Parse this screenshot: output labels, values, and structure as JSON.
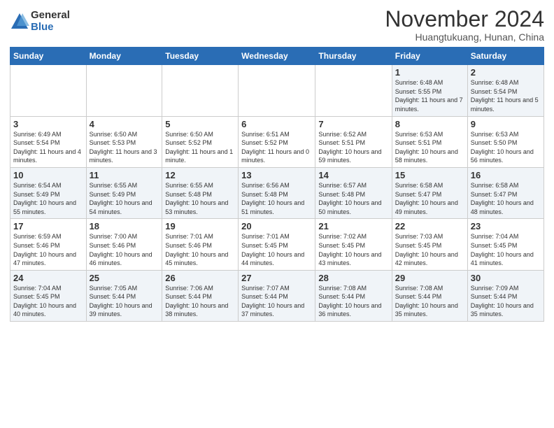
{
  "logo": {
    "general": "General",
    "blue": "Blue"
  },
  "header": {
    "title": "November 2024",
    "subtitle": "Huangtukuang, Hunan, China"
  },
  "days_of_week": [
    "Sunday",
    "Monday",
    "Tuesday",
    "Wednesday",
    "Thursday",
    "Friday",
    "Saturday"
  ],
  "weeks": [
    [
      {
        "day": "",
        "info": ""
      },
      {
        "day": "",
        "info": ""
      },
      {
        "day": "",
        "info": ""
      },
      {
        "day": "",
        "info": ""
      },
      {
        "day": "",
        "info": ""
      },
      {
        "day": "1",
        "info": "Sunrise: 6:48 AM\nSunset: 5:55 PM\nDaylight: 11 hours and 7 minutes."
      },
      {
        "day": "2",
        "info": "Sunrise: 6:48 AM\nSunset: 5:54 PM\nDaylight: 11 hours and 5 minutes."
      }
    ],
    [
      {
        "day": "3",
        "info": "Sunrise: 6:49 AM\nSunset: 5:54 PM\nDaylight: 11 hours and 4 minutes."
      },
      {
        "day": "4",
        "info": "Sunrise: 6:50 AM\nSunset: 5:53 PM\nDaylight: 11 hours and 3 minutes."
      },
      {
        "day": "5",
        "info": "Sunrise: 6:50 AM\nSunset: 5:52 PM\nDaylight: 11 hours and 1 minute."
      },
      {
        "day": "6",
        "info": "Sunrise: 6:51 AM\nSunset: 5:52 PM\nDaylight: 11 hours and 0 minutes."
      },
      {
        "day": "7",
        "info": "Sunrise: 6:52 AM\nSunset: 5:51 PM\nDaylight: 10 hours and 59 minutes."
      },
      {
        "day": "8",
        "info": "Sunrise: 6:53 AM\nSunset: 5:51 PM\nDaylight: 10 hours and 58 minutes."
      },
      {
        "day": "9",
        "info": "Sunrise: 6:53 AM\nSunset: 5:50 PM\nDaylight: 10 hours and 56 minutes."
      }
    ],
    [
      {
        "day": "10",
        "info": "Sunrise: 6:54 AM\nSunset: 5:49 PM\nDaylight: 10 hours and 55 minutes."
      },
      {
        "day": "11",
        "info": "Sunrise: 6:55 AM\nSunset: 5:49 PM\nDaylight: 10 hours and 54 minutes."
      },
      {
        "day": "12",
        "info": "Sunrise: 6:55 AM\nSunset: 5:48 PM\nDaylight: 10 hours and 53 minutes."
      },
      {
        "day": "13",
        "info": "Sunrise: 6:56 AM\nSunset: 5:48 PM\nDaylight: 10 hours and 51 minutes."
      },
      {
        "day": "14",
        "info": "Sunrise: 6:57 AM\nSunset: 5:48 PM\nDaylight: 10 hours and 50 minutes."
      },
      {
        "day": "15",
        "info": "Sunrise: 6:58 AM\nSunset: 5:47 PM\nDaylight: 10 hours and 49 minutes."
      },
      {
        "day": "16",
        "info": "Sunrise: 6:58 AM\nSunset: 5:47 PM\nDaylight: 10 hours and 48 minutes."
      }
    ],
    [
      {
        "day": "17",
        "info": "Sunrise: 6:59 AM\nSunset: 5:46 PM\nDaylight: 10 hours and 47 minutes."
      },
      {
        "day": "18",
        "info": "Sunrise: 7:00 AM\nSunset: 5:46 PM\nDaylight: 10 hours and 46 minutes."
      },
      {
        "day": "19",
        "info": "Sunrise: 7:01 AM\nSunset: 5:46 PM\nDaylight: 10 hours and 45 minutes."
      },
      {
        "day": "20",
        "info": "Sunrise: 7:01 AM\nSunset: 5:45 PM\nDaylight: 10 hours and 44 minutes."
      },
      {
        "day": "21",
        "info": "Sunrise: 7:02 AM\nSunset: 5:45 PM\nDaylight: 10 hours and 43 minutes."
      },
      {
        "day": "22",
        "info": "Sunrise: 7:03 AM\nSunset: 5:45 PM\nDaylight: 10 hours and 42 minutes."
      },
      {
        "day": "23",
        "info": "Sunrise: 7:04 AM\nSunset: 5:45 PM\nDaylight: 10 hours and 41 minutes."
      }
    ],
    [
      {
        "day": "24",
        "info": "Sunrise: 7:04 AM\nSunset: 5:45 PM\nDaylight: 10 hours and 40 minutes."
      },
      {
        "day": "25",
        "info": "Sunrise: 7:05 AM\nSunset: 5:44 PM\nDaylight: 10 hours and 39 minutes."
      },
      {
        "day": "26",
        "info": "Sunrise: 7:06 AM\nSunset: 5:44 PM\nDaylight: 10 hours and 38 minutes."
      },
      {
        "day": "27",
        "info": "Sunrise: 7:07 AM\nSunset: 5:44 PM\nDaylight: 10 hours and 37 minutes."
      },
      {
        "day": "28",
        "info": "Sunrise: 7:08 AM\nSunset: 5:44 PM\nDaylight: 10 hours and 36 minutes."
      },
      {
        "day": "29",
        "info": "Sunrise: 7:08 AM\nSunset: 5:44 PM\nDaylight: 10 hours and 35 minutes."
      },
      {
        "day": "30",
        "info": "Sunrise: 7:09 AM\nSunset: 5:44 PM\nDaylight: 10 hours and 35 minutes."
      }
    ]
  ]
}
